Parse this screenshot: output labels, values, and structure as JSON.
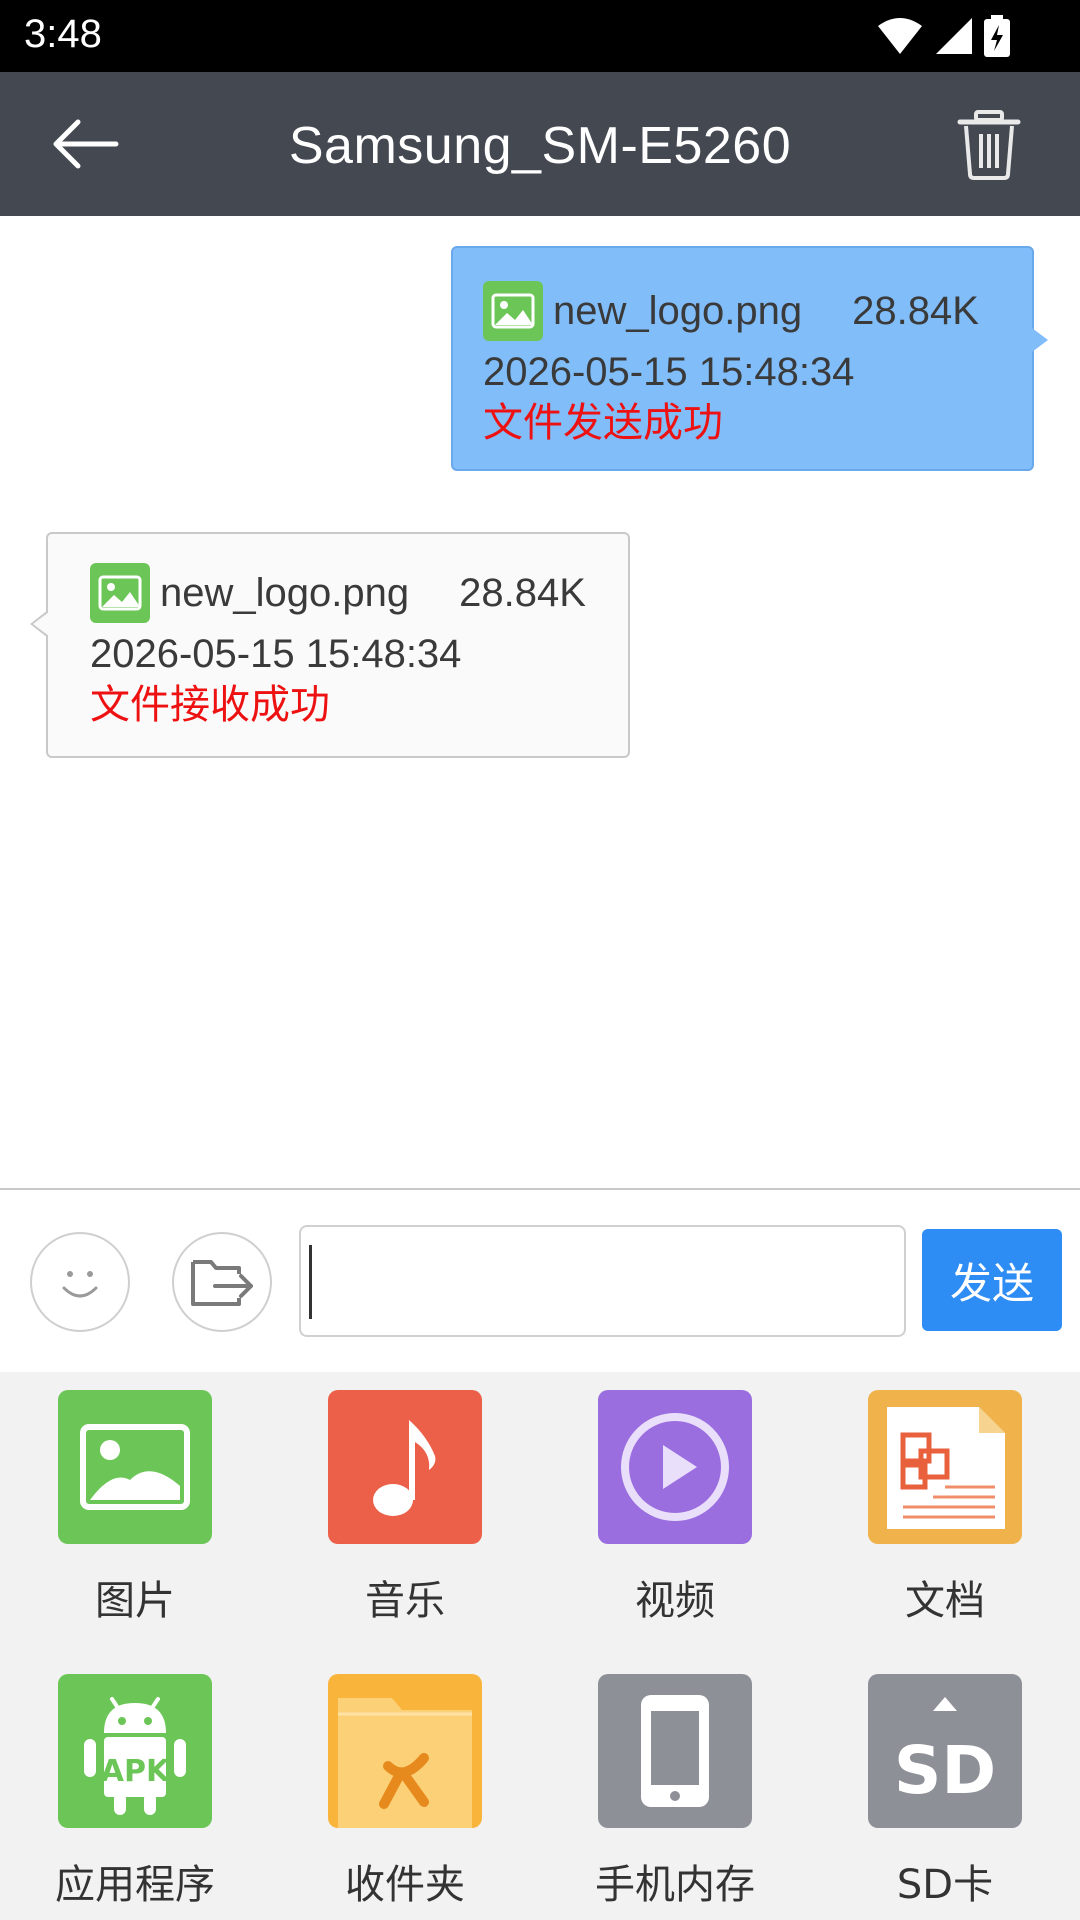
{
  "status_bar": {
    "time": "3:48"
  },
  "header": {
    "title": "Samsung_SM-E5260"
  },
  "messages": [
    {
      "direction": "out",
      "file_name": "new_logo.png",
      "file_size": "28.84K",
      "timestamp": "2026-05-15 15:48:34",
      "status": "文件发送成功"
    },
    {
      "direction": "in",
      "file_name": "new_logo.png",
      "file_size": "28.84K",
      "timestamp": "2026-05-15 15:48:34",
      "status": "文件接收成功"
    }
  ],
  "input": {
    "value": "",
    "send_label": "发送"
  },
  "tools": [
    {
      "label": "图片",
      "icon": "image-icon",
      "color": "#6cc657"
    },
    {
      "label": "音乐",
      "icon": "music-icon",
      "color": "#ec5f48"
    },
    {
      "label": "视频",
      "icon": "video-icon",
      "color": "#9b6ee0"
    },
    {
      "label": "文档",
      "icon": "document-icon",
      "color": "#f0b24a"
    },
    {
      "label": "应用程序",
      "icon": "apk-icon",
      "color": "#6cc657"
    },
    {
      "label": "收件夹",
      "icon": "folder-icon",
      "color": "#f9b43c"
    },
    {
      "label": "手机内存",
      "icon": "phone-storage-icon",
      "color": "#8e9097"
    },
    {
      "label": "SD卡",
      "icon": "sd-card-icon",
      "color": "#8e9097"
    }
  ],
  "colors": {
    "header_bg": "#444851",
    "outgoing_bubble": "#80bdf9",
    "incoming_bubble": "#fafafa",
    "status_text": "#ee1111",
    "send_button": "#2e8cf5"
  }
}
